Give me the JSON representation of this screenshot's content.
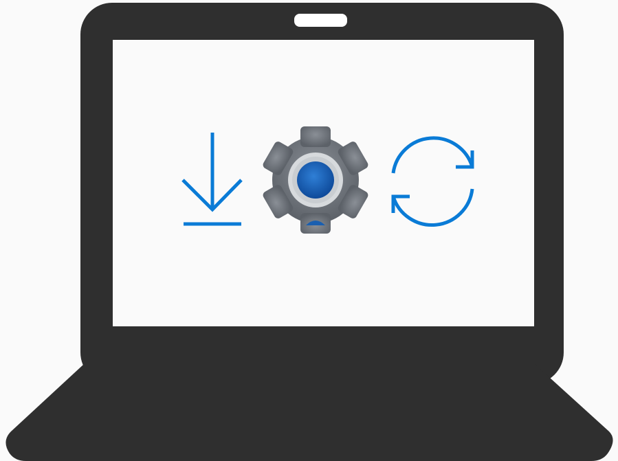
{
  "illustration": {
    "subject": "laptop",
    "icons": [
      "download-icon",
      "settings-gear-icon",
      "sync-refresh-icon"
    ]
  },
  "colors": {
    "background": "#fafafa",
    "laptop_body": "#2f2f2f",
    "screen": "#fafafa",
    "webcam": "#ffffff",
    "accent_blue": "#0a7bd6",
    "gear_gray": "#6f747b",
    "gear_ring": "#d7dadd",
    "gear_center": "#1a5fb0"
  }
}
